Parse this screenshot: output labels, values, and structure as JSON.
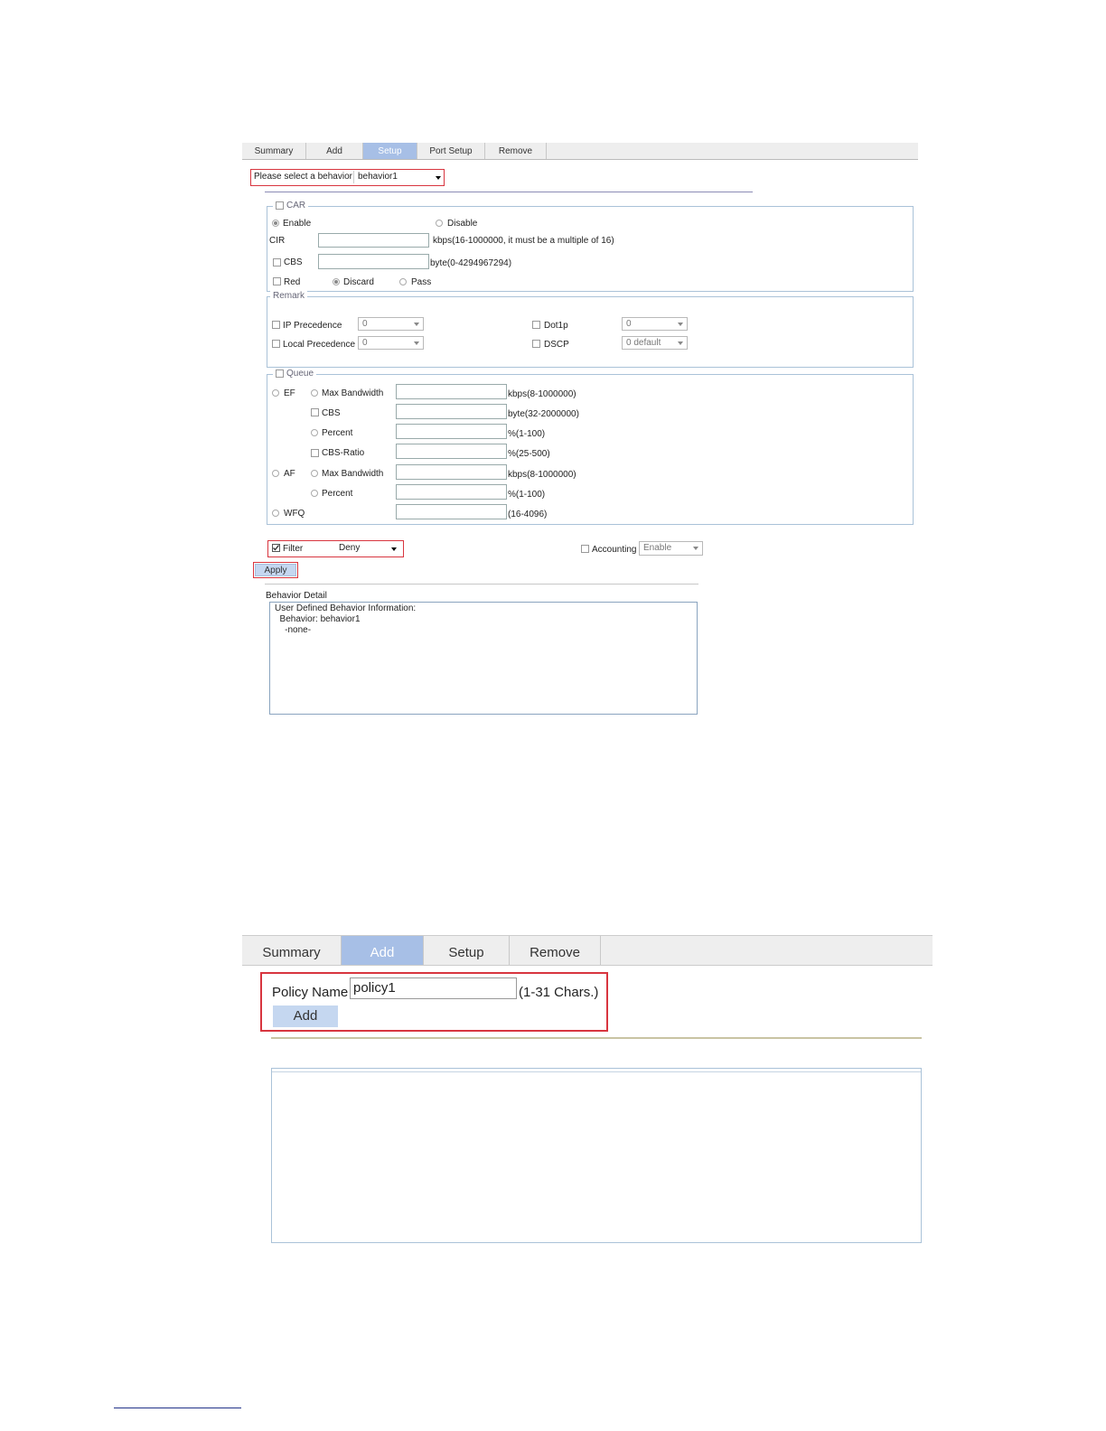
{
  "screen1": {
    "tabs": [
      "Summary",
      "Add",
      "Setup",
      "Port Setup",
      "Remove"
    ],
    "active_tab": "Setup",
    "behavior_label": "Please select a behavior",
    "behavior_value": "behavior1",
    "car": {
      "legend": "CAR",
      "enable": "Enable",
      "disable": "Disable",
      "cir_label": "CIR",
      "cir_hint": "kbps(16-1000000, it must be a multiple of 16)",
      "cbs_label": "CBS",
      "cbs_hint": "byte(0-4294967294)",
      "red_label": "Red",
      "discard": "Discard",
      "pass": "Pass"
    },
    "remark": {
      "legend": "Remark",
      "ip_precedence": "IP Precedence",
      "ip_precedence_value": "0",
      "local_precedence": "Local Precedence",
      "local_precedence_value": "0",
      "dot1p": "Dot1p",
      "dot1p_value": "0",
      "dscp": "DSCP",
      "dscp_value": "0 default"
    },
    "queue": {
      "legend": "Queue",
      "ef": "EF",
      "af": "AF",
      "wfq": "WFQ",
      "max_bandwidth": "Max Bandwidth",
      "cbs": "CBS",
      "percent": "Percent",
      "cbs_ratio": "CBS-Ratio",
      "ef_maxbw_hint": "kbps(8-1000000)",
      "ef_cbs_hint": "byte(32-2000000)",
      "ef_percent_hint": "%(1-100)",
      "cbs_ratio_hint": "%(25-500)",
      "af_maxbw_hint": "kbps(8-1000000)",
      "af_percent_hint": "%(1-100)",
      "wfq_hint": "(16-4096)"
    },
    "filter_label": "Filter",
    "filter_value": "Deny",
    "accounting_label": "Accounting",
    "accounting_value": "Enable",
    "apply_label": "Apply",
    "detail_title": "Behavior Detail",
    "detail_lines": [
      "User Defined Behavior Information:",
      "  Behavior: behavior1",
      "    -none-"
    ]
  },
  "screen2": {
    "tabs": [
      "Summary",
      "Add",
      "Setup",
      "Remove"
    ],
    "active_tab": "Add",
    "policy_name_label": "Policy Name",
    "policy_name_value": "policy1",
    "policy_name_hint": "(1-31 Chars.)",
    "add_button": "Add"
  },
  "colors": {
    "accent_tab": "#a7bfe6",
    "highlight_red": "#d8353f",
    "fieldset_border": "#aac2d8"
  }
}
